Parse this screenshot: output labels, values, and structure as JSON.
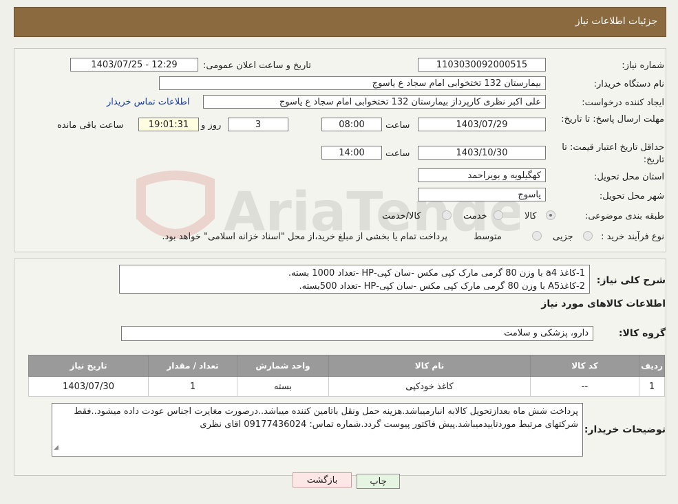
{
  "header": {
    "title": "جزئیات اطلاعات نیاز"
  },
  "labels": {
    "need_number": "شماره نیاز:",
    "announce_date": "تاریخ و ساعت اعلان عمومی:",
    "buyer_org": "نام دستگاه خریدار:",
    "requester": "ایجاد کننده درخواست:",
    "contact_link": "اطلاعات تماس خریدار",
    "deadline": "مهلت ارسال پاسخ: تا تاریخ:",
    "time_word": "ساعت",
    "day_word": "روز و",
    "remaining": "ساعت باقی مانده",
    "validity": "حداقل تاریخ اعتبار قیمت: تا تاریخ:",
    "province": "استان محل تحویل:",
    "city": "شهر محل تحویل:",
    "category": "طبقه بندی موضوعی:",
    "process": "نوع فرآیند خرید :",
    "general_desc": "شرح کلی نیاز:",
    "goods_info": "اطلاعات کالاهای مورد نیاز",
    "goods_group": "گروه کالا:",
    "buyer_notes": "توضیحات خریدار:"
  },
  "values": {
    "need_number": "1103030092000515",
    "announce_date": "1403/07/25 - 12:29",
    "buyer_org": "بیمارستان 132 تختخوابی امام سجاد  ع  یاسوج",
    "requester": "علی اکبر نظری  کارپرداز بیمارستان 132 تختخوابی امام سجاد  ع  یاسوج",
    "deadline_date": "1403/07/29",
    "deadline_time": "08:00",
    "days_left": "3",
    "time_left": "19:01:31",
    "validity_date": "1403/10/30",
    "validity_time": "14:00",
    "province": "کهگیلویه و بویراحمد",
    "city": "یاسوج"
  },
  "category_options": {
    "goods": "کالا",
    "service": "خدمت",
    "goods_service": "کالا/خدمت"
  },
  "process_options": {
    "partial": "جزیی",
    "medium": "متوسط"
  },
  "process_note": "پرداخت تمام یا بخشی از مبلغ خرید،از محل \"اسناد خزانه اسلامی\" خواهد بود.",
  "general_desc": {
    "line1": "1-کاغذ a4 با وزن 80 گرمی مارک کپی مکس -سان کپی-HP -تعداد 1000 بسته.",
    "line2": "2-کاغذA5 با وزن 80 گرمی مارک کپی مکس -سان کپی-HP -تعداد 500بسته."
  },
  "goods_group": "دارو، پزشکی و سلامت",
  "table": {
    "headers": [
      "ردیف",
      "کد کالا",
      "نام کالا",
      "واحد شمارش",
      "تعداد / مقدار",
      "تاریخ نیاز"
    ],
    "rows": [
      [
        "1",
        "--",
        "کاغذ خودکپی",
        "بسته",
        "1",
        "1403/07/30"
      ]
    ]
  },
  "buyer_notes": "پرداخت شش ماه بعدازتحویل کالابه انبارمیباشد.هزینه حمل ونقل باتامین کننده میباشد..درصورت مغایرت اجناس عودت داده میشود..فقط شرکتهای مرتبط موردتاییدمیباشد.پیش فاکتور پیوست گردد.شماره تماس: 09177436024  اقای نظری",
  "buttons": {
    "print": "چاپ",
    "back": "بازگشت"
  },
  "watermark": {
    "text": "AriaTender.neT"
  }
}
